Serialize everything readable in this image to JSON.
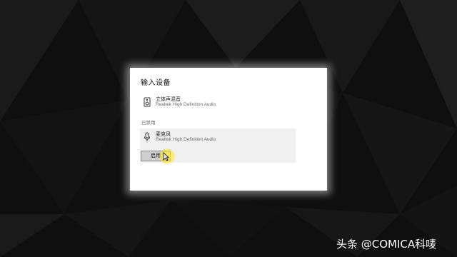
{
  "dialog": {
    "title": "输入设备",
    "devices": [
      {
        "name": "立体声混音",
        "description": "Realtek High Definition Audio",
        "icon": "stereo-mix-icon"
      },
      {
        "name": "麦克风",
        "description": "Realtek High Definition Audio",
        "icon": "microphone-icon"
      }
    ],
    "disabled_label": "已禁用",
    "enable_button": "启用"
  },
  "watermark": "头条 @COMICA科唛",
  "colors": {
    "background": "#0e0e0e",
    "dialog": "#ffffff",
    "selected_row": "#f0f0f0",
    "button": "#cfcfcf",
    "cursor_highlight": "#ffeb3c"
  }
}
